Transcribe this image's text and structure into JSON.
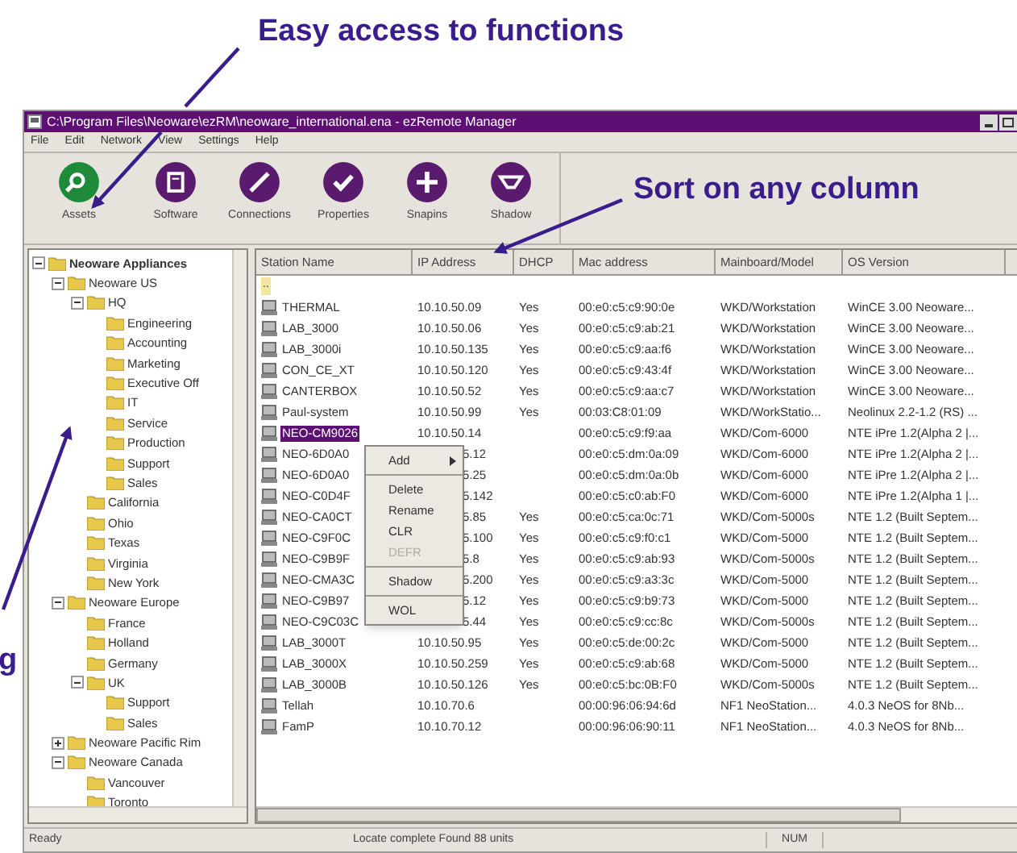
{
  "callouts": [
    {
      "kind": "top",
      "text": "Easy access to functions"
    },
    {
      "kind": "right",
      "text": "Sort on any column"
    },
    {
      "kind": "left",
      "text": "g"
    }
  ],
  "window": {
    "title": "C:\\Program Files\\Neoware\\ezRM\\neoware_international.ena - ezRemote Manager"
  },
  "menu": [
    "File",
    "Edit",
    "Network",
    "View",
    "Settings",
    "Help"
  ],
  "toolbar": [
    {
      "label": "Assets",
      "selected": true
    },
    {
      "label": "Software",
      "selected": false
    },
    {
      "label": "Connections",
      "selected": false
    },
    {
      "label": "Properties",
      "selected": false
    },
    {
      "label": "Snapins",
      "selected": false
    },
    {
      "label": "Shadow",
      "selected": false
    }
  ],
  "tree": [
    {
      "label": "Neoware Appliances",
      "expanded": true,
      "children": [
        {
          "label": "Neoware US",
          "expanded": true,
          "children": [
            {
              "label": "HQ",
              "expanded": true,
              "children": [
                {
                  "label": "Engineering"
                },
                {
                  "label": "Accounting"
                },
                {
                  "label": "Marketing"
                },
                {
                  "label": "Executive Off"
                },
                {
                  "label": "IT"
                },
                {
                  "label": "Service"
                },
                {
                  "label": "Production"
                },
                {
                  "label": "Support"
                },
                {
                  "label": "Sales"
                }
              ]
            },
            {
              "label": "California"
            },
            {
              "label": "Ohio"
            },
            {
              "label": "Texas"
            },
            {
              "label": "Virginia"
            },
            {
              "label": "New York"
            }
          ]
        },
        {
          "label": "Neoware Europe",
          "expanded": true,
          "children": [
            {
              "label": "France"
            },
            {
              "label": "Holland"
            },
            {
              "label": "Germany"
            },
            {
              "label": "UK",
              "expanded": true,
              "children": [
                {
                  "label": "Support"
                },
                {
                  "label": "Sales"
                }
              ]
            }
          ]
        },
        {
          "label": "Neoware Pacific Rim",
          "expanded": false
        },
        {
          "label": "Neoware Canada",
          "expanded": true,
          "children": [
            {
              "label": "Vancouver"
            },
            {
              "label": "Toronto"
            }
          ]
        }
      ]
    }
  ],
  "table": {
    "columns": [
      "Station Name",
      "IP Address",
      "DHCP",
      "Mac address",
      "Mainboard/Model",
      "OS Version"
    ],
    "parent_row": "..",
    "rows": [
      {
        "cells": [
          "THERMAL",
          "10.10.50.09",
          "Yes",
          "00:e0:c5:c9:90:0e",
          "WKD/Workstation",
          "WinCE 3.00 Neoware..."
        ],
        "selected": false
      },
      {
        "cells": [
          "LAB_3000",
          "10.10.50.06",
          "Yes",
          "00:e0:c5:c9:ab:21",
          "WKD/Workstation",
          "WinCE 3.00 Neoware..."
        ],
        "selected": false
      },
      {
        "cells": [
          "LAB_3000i",
          "10.10.50.135",
          "Yes",
          "00:e0:c5:c9:aa:f6",
          "WKD/Workstation",
          "WinCE 3.00 Neoware..."
        ],
        "selected": false
      },
      {
        "cells": [
          "CON_CE_XT",
          "10.10.50.120",
          "Yes",
          "00:e0:c5:c9:43:4f",
          "WKD/Workstation",
          "WinCE 3.00 Neoware..."
        ],
        "selected": false
      },
      {
        "cells": [
          "CANTERBOX",
          "10.10.50.52",
          "Yes",
          "00:e0:c5:c9:aa:c7",
          "WKD/Workstation",
          "WinCE 3.00 Neoware..."
        ],
        "selected": false
      },
      {
        "cells": [
          "Paul-system",
          "10.10.50.99",
          "Yes",
          "00:03:C8:01:09",
          "WKD/WorkStatio...",
          "Neolinux 2.2-1.2 (RS) ..."
        ],
        "selected": false
      },
      {
        "cells": [
          "NEO-CM9026",
          "10.10.50.14",
          "",
          "00:e0:c5:c9:f9:aa",
          "WKD/Com-6000",
          "NTE iPre 1.2(Alpha 2 |..."
        ],
        "selected": true
      },
      {
        "cells": [
          "NEO-6D0A0",
          "5.12",
          "",
          "00:e0:c5:dm:0a:09",
          "WKD/Com-6000",
          "NTE iPre 1.2(Alpha 2 |..."
        ],
        "selected": false
      },
      {
        "cells": [
          "NEO-6D0A0",
          "5.25",
          "",
          "00:e0:c5:dm:0a:0b",
          "WKD/Com-6000",
          "NTE iPre 1.2(Alpha 2 |..."
        ],
        "selected": false
      },
      {
        "cells": [
          "NEO-C0D4F",
          "5.142",
          "",
          "00:e0:c5:c0:ab:F0",
          "WKD/Com-6000",
          "NTE iPre 1.2(Alpha 1 |..."
        ],
        "selected": false
      },
      {
        "cells": [
          "NEO-CA0CT",
          "5.85",
          "Yes",
          "00:e0:c5:ca:0c:71",
          "WKD/Com-5000s",
          "NTE 1.2 (Built Septem..."
        ],
        "selected": false
      },
      {
        "cells": [
          "NEO-C9F0C",
          "5.100",
          "Yes",
          "00:e0:c5:c9:f0:c1",
          "WKD/Com-5000",
          "NTE 1.2 (Built Septem..."
        ],
        "selected": false
      },
      {
        "cells": [
          "NEO-C9B9F",
          "5.8",
          "Yes",
          "00:e0:c5:c9:ab:93",
          "WKD/Com-5000s",
          "NTE 1.2 (Built Septem..."
        ],
        "selected": false
      },
      {
        "cells": [
          "NEO-CMA3C",
          "5.200",
          "Yes",
          "00:e0:c5:c9:a3:3c",
          "WKD/Com-5000",
          "NTE 1.2 (Built Septem..."
        ],
        "selected": false
      },
      {
        "cells": [
          "NEO-C9B97",
          "5.12",
          "Yes",
          "00:e0:c5:c9:b9:73",
          "WKD/Com-5000",
          "NTE 1.2 (Built Septem..."
        ],
        "selected": false
      },
      {
        "cells": [
          "NEO-C9C03C",
          "5.44",
          "Yes",
          "00:e0:c5:c9:cc:8c",
          "WKD/Com-5000s",
          "NTE 1.2 (Built Septem..."
        ],
        "selected": false
      },
      {
        "cells": [
          "LAB_3000T",
          "10.10.50.95",
          "Yes",
          "00:e0:c5:de:00:2c",
          "WKD/Com-5000",
          "NTE 1.2 (Built Septem..."
        ],
        "selected": false
      },
      {
        "cells": [
          "LAB_3000X",
          "10.10.50.259",
          "Yes",
          "00:e0:c5:c9:ab:68",
          "WKD/Com-5000",
          "NTE 1.2 (Built Septem..."
        ],
        "selected": false
      },
      {
        "cells": [
          "LAB_3000B",
          "10.10.50.126",
          "Yes",
          "00:e0:c5:bc:0B:F0",
          "WKD/Com-5000s",
          "NTE 1.2 (Built Septem..."
        ],
        "selected": false
      },
      {
        "cells": [
          "Tellah",
          "10.10.70.6",
          "",
          "00:00:96:06:94:6d",
          "NF1 NeoStation...",
          "4.0.3 NeOS for 8Nb..."
        ],
        "selected": false
      },
      {
        "cells": [
          "FamP",
          "10.10.70.12",
          "",
          "00:00:96:06:90:11",
          "NF1 NeoStation...",
          "4.0.3 NeOS for 8Nb..."
        ],
        "selected": false
      }
    ]
  },
  "context_menu": [
    {
      "kind": "submenu",
      "label": "Add",
      "disabled": false
    },
    {
      "kind": "separator"
    },
    {
      "kind": "command",
      "label": "Delete",
      "disabled": false
    },
    {
      "kind": "command",
      "label": "Rename",
      "disabled": false
    },
    {
      "kind": "command",
      "label": "CLR",
      "disabled": false
    },
    {
      "kind": "command",
      "label": "DEFR",
      "disabled": true
    },
    {
      "kind": "separator"
    },
    {
      "kind": "command",
      "label": "Shadow",
      "disabled": false
    },
    {
      "kind": "separator"
    },
    {
      "kind": "command",
      "label": "WOL",
      "disabled": false
    }
  ],
  "status_bar": [
    "Ready",
    "Locate complete Found 88 units",
    "NUM"
  ]
}
